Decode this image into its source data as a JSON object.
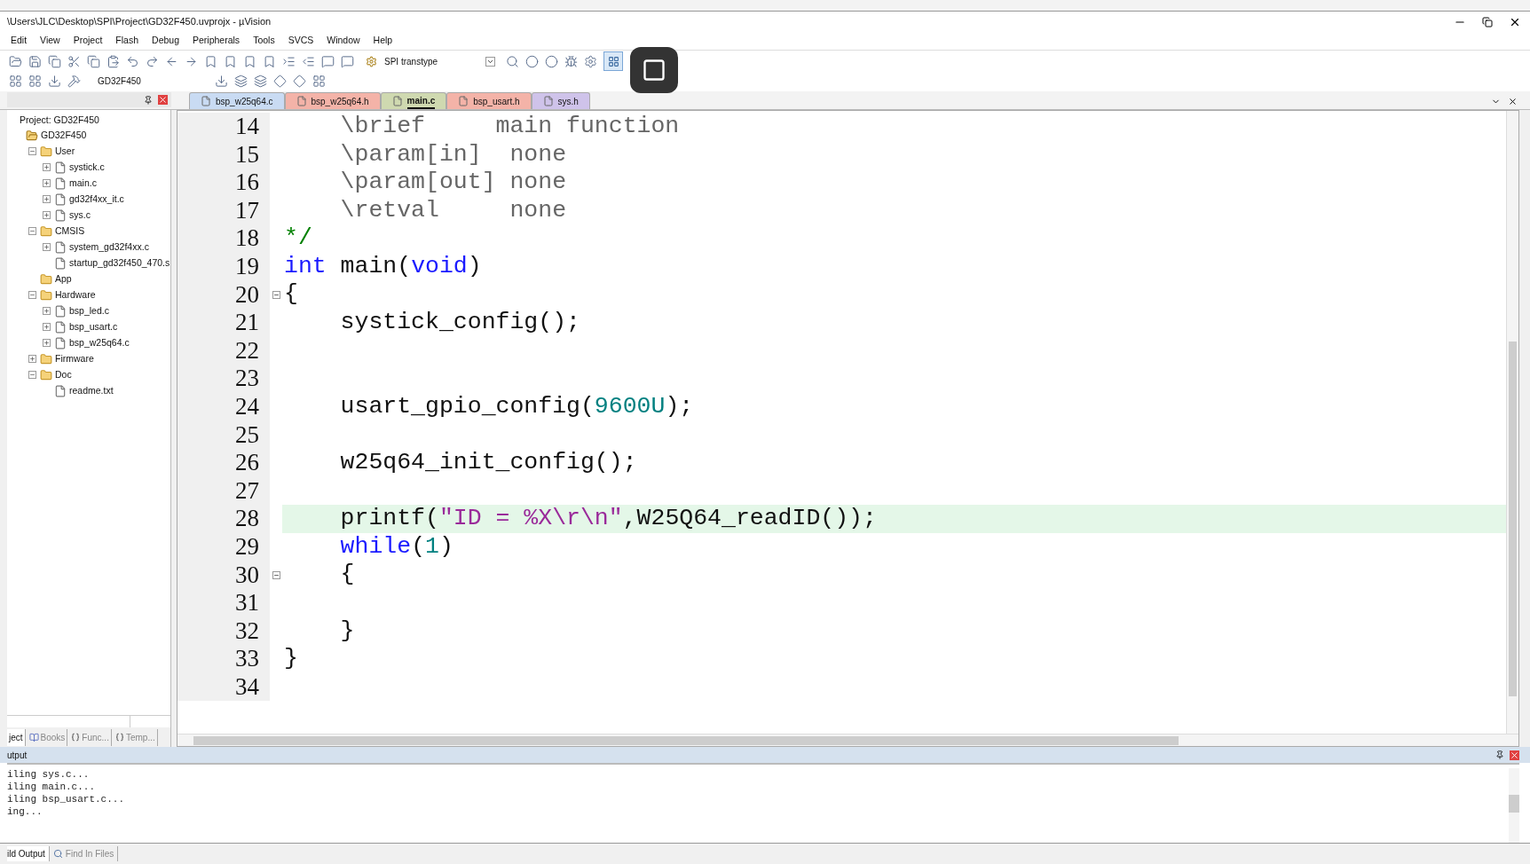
{
  "window": {
    "title": "\\Users\\JLC\\Desktop\\SPI\\Project\\GD32F450.uvprojx - µVision"
  },
  "menu": [
    "Edit",
    "View",
    "Project",
    "Flash",
    "Debug",
    "Peripherals",
    "Tools",
    "SVCS",
    "Window",
    "Help"
  ],
  "toolbar": {
    "target_combo": "SPI transtype",
    "target_field": "GD32F450"
  },
  "editor_tabs": [
    {
      "label": "bsp_w25q64.c",
      "selected": false,
      "color": "#c9dbf3"
    },
    {
      "label": "bsp_w25q64.h",
      "selected": false,
      "color": "#f4b3a8"
    },
    {
      "label": "main.c",
      "selected": true,
      "color": "#cfd9b0"
    },
    {
      "label": "bsp_usart.h",
      "selected": false,
      "color": "#f4b3a8"
    },
    {
      "label": "sys.h",
      "selected": false,
      "color": "#cfc3ea"
    }
  ],
  "project_tree": {
    "title": "Project: GD32F450",
    "items": [
      {
        "label": "GD32F450",
        "kind": "project",
        "children": [
          {
            "label": "User",
            "kind": "folder",
            "expanded": true,
            "children": [
              {
                "label": "systick.c",
                "kind": "file",
                "expanded": false
              },
              {
                "label": "main.c",
                "kind": "file",
                "expanded": false
              },
              {
                "label": "gd32f4xx_it.c",
                "kind": "file",
                "expanded": false
              },
              {
                "label": "sys.c",
                "kind": "file",
                "expanded": false
              }
            ]
          },
          {
            "label": "CMSIS",
            "kind": "folder",
            "expanded": true,
            "children": [
              {
                "label": "system_gd32f4xx.c",
                "kind": "file",
                "expanded": false
              },
              {
                "label": "startup_gd32f450_470.s",
                "kind": "file"
              }
            ]
          },
          {
            "label": "App",
            "kind": "folder"
          },
          {
            "label": "Hardware",
            "kind": "folder",
            "expanded": true,
            "children": [
              {
                "label": "bsp_led.c",
                "kind": "file",
                "expanded": false
              },
              {
                "label": "bsp_usart.c",
                "kind": "file",
                "expanded": false
              },
              {
                "label": "bsp_w25q64.c",
                "kind": "file",
                "expanded": false
              }
            ]
          },
          {
            "label": "Firmware",
            "kind": "folder",
            "expanded": false
          },
          {
            "label": "Doc",
            "kind": "folder",
            "expanded": true,
            "children": [
              {
                "label": "readme.txt",
                "kind": "file"
              }
            ]
          }
        ]
      }
    ]
  },
  "panel_tabs": [
    {
      "label": "ject",
      "selected": true
    },
    {
      "label": "Books",
      "selected": false
    },
    {
      "label": "Func...",
      "selected": false
    },
    {
      "label": "Temp...",
      "selected": false
    }
  ],
  "code_lines": [
    {
      "number": "14",
      "fold": false,
      "highlighted": false,
      "tokens": [
        {
          "kind": "doc",
          "text": "    \\brief     main function"
        }
      ]
    },
    {
      "number": "15",
      "fold": false,
      "highlighted": false,
      "tokens": [
        {
          "kind": "doc",
          "text": "    \\param[in]  none"
        }
      ]
    },
    {
      "number": "16",
      "fold": false,
      "highlighted": false,
      "tokens": [
        {
          "kind": "doc",
          "text": "    \\param[out] none"
        }
      ]
    },
    {
      "number": "17",
      "fold": false,
      "highlighted": false,
      "tokens": [
        {
          "kind": "doc",
          "text": "    \\retval     none"
        }
      ]
    },
    {
      "number": "18",
      "fold": false,
      "highlighted": false,
      "tokens": [
        {
          "kind": "comment",
          "text": "*/"
        }
      ]
    },
    {
      "number": "19",
      "fold": false,
      "highlighted": false,
      "tokens": [
        {
          "kind": "keyword",
          "text": "int"
        },
        {
          "kind": "plain",
          "text": " main("
        },
        {
          "kind": "keyword",
          "text": "void"
        },
        {
          "kind": "plain",
          "text": ")"
        }
      ]
    },
    {
      "number": "20",
      "fold": true,
      "highlighted": false,
      "tokens": [
        {
          "kind": "plain",
          "text": "{"
        }
      ]
    },
    {
      "number": "21",
      "fold": false,
      "highlighted": false,
      "tokens": [
        {
          "kind": "plain",
          "text": "    systick_config();"
        }
      ]
    },
    {
      "number": "22",
      "fold": false,
      "highlighted": false
    },
    {
      "number": "23",
      "fold": false,
      "highlighted": false
    },
    {
      "number": "24",
      "fold": false,
      "highlighted": false,
      "tokens": [
        {
          "kind": "plain",
          "text": "    usart_gpio_config("
        },
        {
          "kind": "number",
          "text": "9600U"
        },
        {
          "kind": "plain",
          "text": ");"
        }
      ]
    },
    {
      "number": "25",
      "fold": false,
      "highlighted": false
    },
    {
      "number": "26",
      "fold": false,
      "highlighted": false,
      "tokens": [
        {
          "kind": "plain",
          "text": "    w25q64_init_config();"
        }
      ]
    },
    {
      "number": "27",
      "fold": false,
      "highlighted": false
    },
    {
      "number": "28",
      "fold": false,
      "highlighted": true,
      "tokens": [
        {
          "kind": "plain",
          "text": "    printf("
        },
        {
          "kind": "string",
          "text": "\"ID = %X\\r\\n\""
        },
        {
          "kind": "plain",
          "text": ",W25Q64_readID());"
        }
      ]
    },
    {
      "number": "29",
      "fold": false,
      "highlighted": false,
      "tokens": [
        {
          "kind": "keyword",
          "text": "    while"
        },
        {
          "kind": "plain",
          "text": "("
        },
        {
          "kind": "number",
          "text": "1"
        },
        {
          "kind": "plain",
          "text": ")"
        }
      ]
    },
    {
      "number": "30",
      "fold": true,
      "highlighted": false,
      "tokens": [
        {
          "kind": "plain",
          "text": "    {"
        }
      ]
    },
    {
      "number": "31",
      "fold": false,
      "highlighted": false
    },
    {
      "number": "32",
      "fold": false,
      "highlighted": false,
      "tokens": [
        {
          "kind": "plain",
          "text": "    }"
        }
      ]
    },
    {
      "number": "33",
      "fold": false,
      "highlighted": false,
      "tokens": [
        {
          "kind": "plain",
          "text": "}"
        }
      ]
    },
    {
      "number": "34",
      "fold": false,
      "highlighted": false
    }
  ],
  "output": {
    "title": "utput",
    "lines": [
      "iling sys.c...",
      "iling main.c...",
      "iling bsp_usart.c...",
      "ing..."
    ]
  },
  "output_tabs": [
    {
      "label": "ild Output",
      "selected": true
    },
    {
      "label": "Find In Files",
      "selected": false
    }
  ]
}
